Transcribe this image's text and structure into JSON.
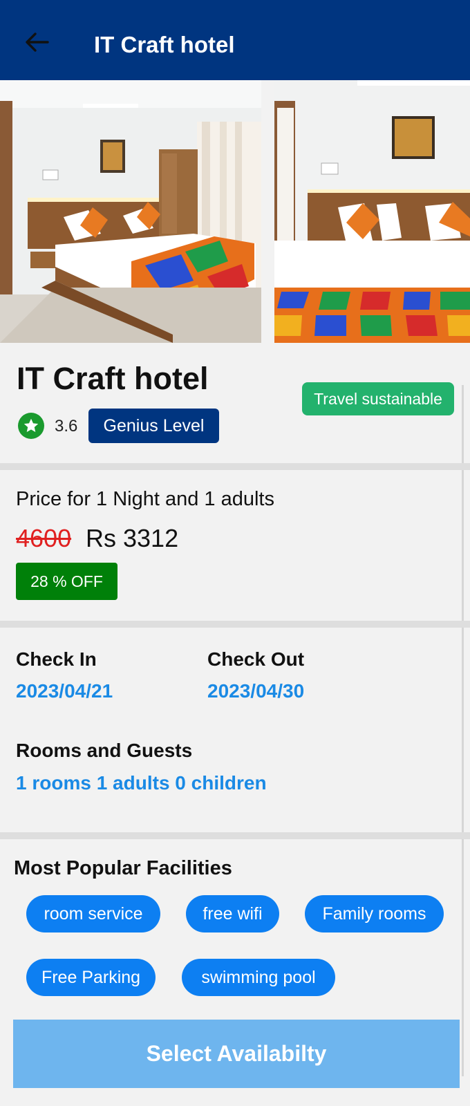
{
  "appbar": {
    "title": "IT Craft hotel",
    "back_icon": "arrow-left-icon"
  },
  "hotel": {
    "name": "IT Craft hotel",
    "rating": "3.6",
    "rating_icon": "star-icon",
    "genius_label": "Genius Level",
    "sustainable_label": "Travel sustainable"
  },
  "price": {
    "label": "Price for 1 Night and 1 adults",
    "old_price": "4600",
    "new_price": "Rs 3312",
    "discount": "28 % OFF"
  },
  "stay": {
    "check_in_label": "Check In",
    "check_in_value": "2023/04/21",
    "check_out_label": "Check Out",
    "check_out_value": "2023/04/30",
    "rooms_label": "Rooms and Guests",
    "rooms_value": "1 rooms 1 adults 0 children"
  },
  "facilities": {
    "title": "Most Popular Facilities",
    "items": [
      "room service",
      "free wifi",
      "Family rooms",
      "Free Parking",
      "swimming pool"
    ]
  },
  "cta": {
    "label": "Select Availabilty"
  },
  "colors": {
    "brand": "#003580",
    "link": "#1a8ae5",
    "chip": "#0d7ff2",
    "discount": "#008009",
    "sustainable": "#23b26d",
    "old_price": "#e02020",
    "cta": "#6eb5ee"
  }
}
